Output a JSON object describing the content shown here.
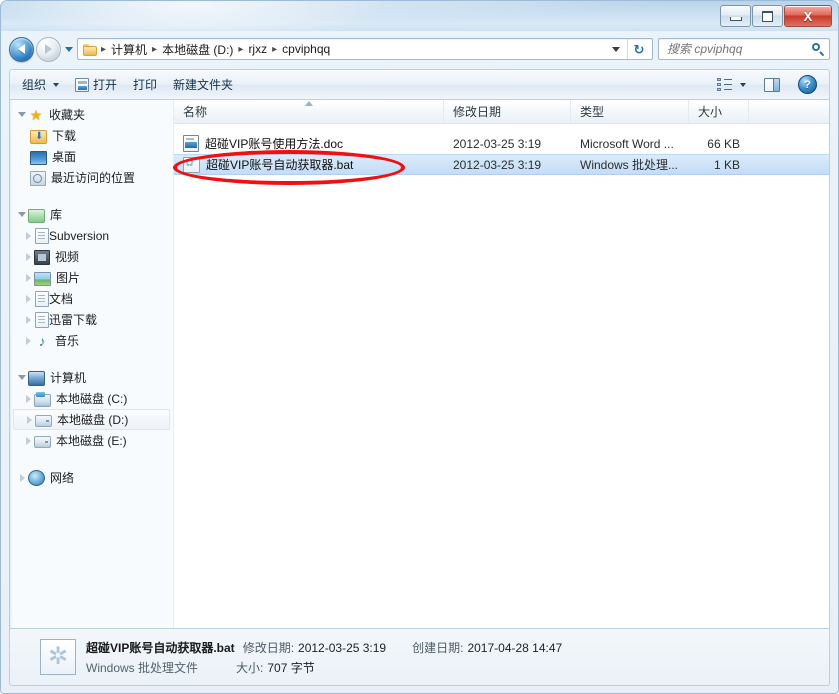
{
  "window": {
    "controls": {
      "minimize": "—",
      "maximize": "❐",
      "close": "X"
    }
  },
  "address_bar": {
    "back_tooltip": "后退",
    "forward_tooltip": "前进",
    "breadcrumbs": [
      "计算机",
      "本地磁盘 (D:)",
      "rjxz",
      "cpviphqq"
    ],
    "separator": "▸",
    "refresh": "↻"
  },
  "search": {
    "placeholder": "搜索 cpviphqq",
    "value": ""
  },
  "toolbar": {
    "organize": "组织",
    "open": "打开",
    "print": "打印",
    "new_folder": "新建文件夹",
    "help": "?"
  },
  "sidebar": {
    "groups": [
      {
        "title": "收藏夹",
        "icon": "star-icon",
        "items": [
          {
            "label": "下载",
            "icon": "download-folder-icon"
          },
          {
            "label": "桌面",
            "icon": "desktop-icon"
          },
          {
            "label": "最近访问的位置",
            "icon": "recent-places-icon"
          }
        ]
      },
      {
        "title": "库",
        "icon": "library-icon",
        "items": [
          {
            "label": "Subversion",
            "icon": "document-library-icon"
          },
          {
            "label": "视频",
            "icon": "video-library-icon"
          },
          {
            "label": "图片",
            "icon": "picture-library-icon"
          },
          {
            "label": "文档",
            "icon": "document-library-icon"
          },
          {
            "label": "迅雷下载",
            "icon": "document-library-icon"
          },
          {
            "label": "音乐",
            "icon": "music-library-icon"
          }
        ]
      },
      {
        "title": "计算机",
        "icon": "computer-icon",
        "items": [
          {
            "label": "本地磁盘 (C:)",
            "icon": "system-drive-icon",
            "selected": false
          },
          {
            "label": "本地磁盘 (D:)",
            "icon": "drive-icon",
            "selected": true
          },
          {
            "label": "本地磁盘 (E:)",
            "icon": "drive-icon",
            "selected": false
          }
        ]
      },
      {
        "title": "网络",
        "icon": "network-icon",
        "items": []
      }
    ]
  },
  "file_list": {
    "columns": [
      "名称",
      "修改日期",
      "类型",
      "大小"
    ],
    "rows": [
      {
        "name": "超碰VIP账号使用方法.doc",
        "modified": "2012-03-25 3:19",
        "type": "Microsoft Word ...",
        "size": "66 KB",
        "icon": "word-document-icon",
        "selected": false
      },
      {
        "name": "超碰VIP账号自动获取器.bat",
        "modified": "2012-03-25 3:19",
        "type": "Windows 批处理...",
        "size": "1 KB",
        "icon": "batch-file-icon",
        "selected": true
      }
    ]
  },
  "status_bar": {
    "file_name": "超碰VIP账号自动获取器.bat",
    "modified_label": "修改日期:",
    "modified_value": "2012-03-25 3:19",
    "created_label": "创建日期:",
    "created_value": "2017-04-28 14:47",
    "file_type": "Windows 批处理文件",
    "size_label": "大小:",
    "size_value": "707 字节"
  },
  "colors": {
    "accent": "#2f6ea8",
    "selection": "#cfe4f8",
    "annotation": "#ee1111",
    "close_button": "#c8392a"
  }
}
